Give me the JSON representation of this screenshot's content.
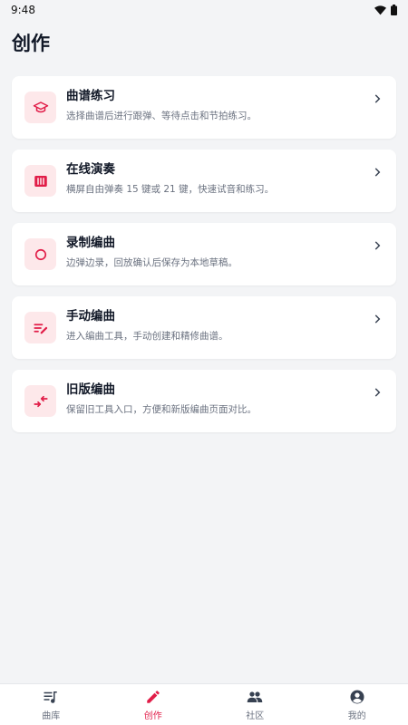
{
  "status": {
    "time": "9:48"
  },
  "page": {
    "title": "创作"
  },
  "cards": [
    {
      "title": "曲谱练习",
      "desc": "选择曲谱后进行跟弹、等待点击和节拍练习。",
      "icon": "graduation-cap-icon"
    },
    {
      "title": "在线演奏",
      "desc": "横屏自由弹奏 15 键或 21 键，快速试音和练习。",
      "icon": "piano-icon"
    },
    {
      "title": "录制编曲",
      "desc": "边弹边录，回放确认后保存为本地草稿。",
      "icon": "record-icon"
    },
    {
      "title": "手动编曲",
      "desc": "进入编曲工具，手动创建和精修曲谱。",
      "icon": "edit-list-icon"
    },
    {
      "title": "旧版编曲",
      "desc": "保留旧工具入口，方便和新版编曲页面对比。",
      "icon": "swap-arrows-icon"
    }
  ],
  "nav": [
    {
      "label": "曲库",
      "active": false
    },
    {
      "label": "创作",
      "active": true
    },
    {
      "label": "社区",
      "active": false
    },
    {
      "label": "我的",
      "active": false
    }
  ],
  "colors": {
    "accent": "#e11d48",
    "icon_bg": "#fde8ea",
    "background": "#f3f4f6"
  }
}
